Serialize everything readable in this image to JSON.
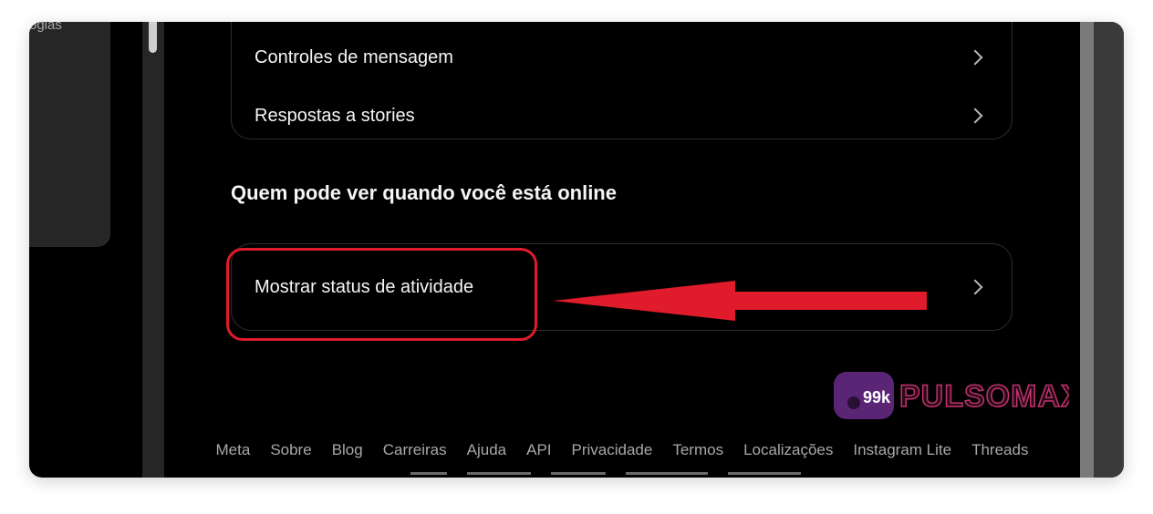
{
  "left_panel": {
    "partial_text": "ogias"
  },
  "card_top": {
    "items": [
      {
        "label": "Controles de mensagem"
      },
      {
        "label": "Respostas a stories"
      }
    ]
  },
  "section": {
    "title": "Quem pode ver quando você está online"
  },
  "activity": {
    "label": "Mostrar status de atividade"
  },
  "footer": {
    "links": [
      "Meta",
      "Sobre",
      "Blog",
      "Carreiras",
      "Ajuda",
      "API",
      "Privacidade",
      "Termos",
      "Localizações",
      "Instagram Lite",
      "Threads"
    ]
  },
  "watermark": {
    "badge": "99k",
    "brand": "PULSOMAX"
  },
  "colors": {
    "highlight": "#e01b2b",
    "background": "#000000",
    "text": "#f5f5f5",
    "muted": "#a8a8a8"
  },
  "icons": {
    "row_chevron": "chevron-right-icon",
    "annotation": "red-arrow-left-icon"
  }
}
